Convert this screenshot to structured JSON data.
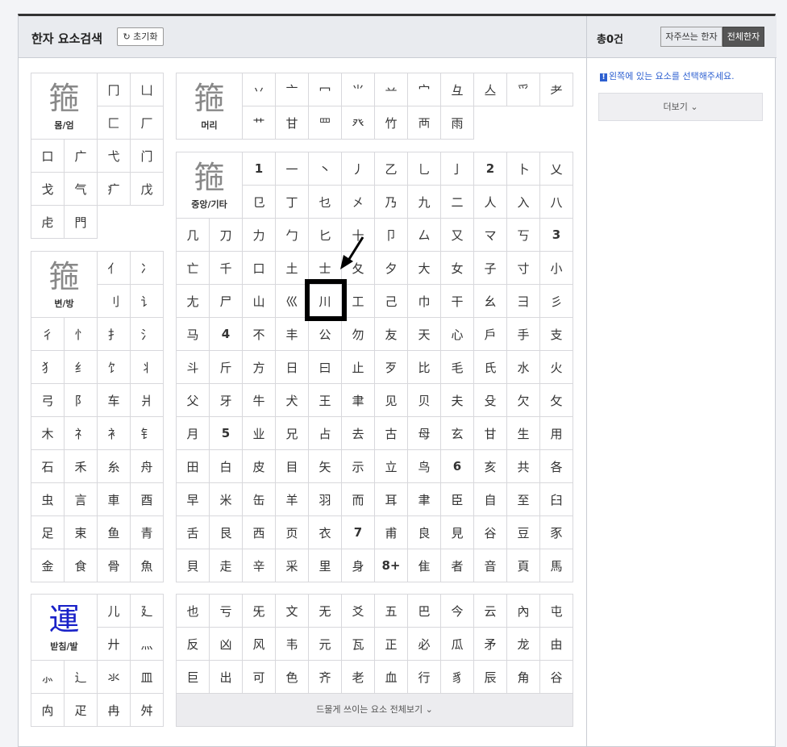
{
  "header": {
    "title": "한자 요소검색",
    "reset_label": "초기화"
  },
  "right": {
    "count": "총0건",
    "toggle_common": "자주쓰는 한자",
    "toggle_all": "전체한자",
    "hint": "왼쪽에 있는 요소를 선택해주세요.",
    "more": "더보기"
  },
  "icons": {
    "reset": "refresh-icon",
    "hint": "exclamation-icon",
    "more": "chevron-down-icon"
  },
  "colors": {
    "accent": "#1a22c8",
    "hint": "#2c5fd0"
  },
  "groups": {
    "mom": {
      "sample": "箍",
      "label": "몸/엄",
      "items": [
        "冂",
        "凵",
        "匚",
        "厂",
        "口",
        "广",
        "弋",
        "门",
        "戈",
        "气",
        "疒",
        "戊",
        "虍",
        "門"
      ]
    },
    "head": {
      "sample": "箍",
      "label": "머리",
      "items": [
        "丷",
        "亠",
        "冖",
        "⺌",
        "䒑",
        "宀",
        "彑",
        "亼",
        "⺤",
        "耂",
        "艹",
        "甘",
        "罒",
        "癶",
        "竹",
        "襾",
        "雨"
      ]
    },
    "mid": {
      "sample": "箍",
      "label": "중앙/기타",
      "items": [
        "1",
        "一",
        "丶",
        "丿",
        "乙",
        "乚",
        "亅",
        "2",
        "卜",
        "乂",
        "㔾",
        "丁",
        "乜",
        "㐅",
        "乃",
        "九",
        "二",
        "人",
        "入",
        "八",
        "几",
        "刀",
        "力",
        "勹",
        "匕",
        "十",
        "卩",
        "厶",
        "又",
        "マ",
        "丂",
        "3",
        "亡",
        "千",
        "口",
        "土",
        "士",
        "夂",
        "夕",
        "大",
        "女",
        "子",
        "寸",
        "小",
        "尢",
        "尸",
        "山",
        "巛",
        "川",
        "工",
        "己",
        "巾",
        "干",
        "幺",
        "彐",
        "彡",
        "马",
        "4",
        "不",
        "丰",
        "公",
        "勿",
        "友",
        "天",
        "心",
        "戶",
        "手",
        "支",
        "斗",
        "斤",
        "方",
        "日",
        "曰",
        "止",
        "歹",
        "比",
        "毛",
        "氏",
        "水",
        "火",
        "父",
        "牙",
        "牛",
        "犬",
        "王",
        "聿",
        "见",
        "贝",
        "夫",
        "殳",
        "欠",
        "攵",
        "月",
        "5",
        "业",
        "兄",
        "占",
        "去",
        "古",
        "母",
        "玄",
        "甘",
        "生",
        "用",
        "田",
        "白",
        "皮",
        "目",
        "矢",
        "示",
        "立",
        "鸟",
        "6",
        "亥",
        "共",
        "各",
        "早",
        "米",
        "缶",
        "羊",
        "羽",
        "而",
        "耳",
        "聿",
        "臣",
        "自",
        "至",
        "臼",
        "舌",
        "艮",
        "西",
        "页",
        "衣",
        "7",
        "甫",
        "良",
        "見",
        "谷",
        "豆",
        "豕",
        "貝",
        "走",
        "辛",
        "采",
        "里",
        "身",
        "8+",
        "隹",
        "者",
        "音",
        "頁",
        "馬"
      ]
    },
    "side": {
      "sample": "箍",
      "label": "변/방",
      "items": [
        "亻",
        "冫",
        "刂",
        "讠",
        "彳",
        "忄",
        "扌",
        "氵",
        "犭",
        "纟",
        "饣",
        "丬",
        "弓",
        "阝",
        "车",
        "爿",
        "木",
        "礻",
        "衤",
        "钅",
        "石",
        "禾",
        "糸",
        "舟",
        "虫",
        "言",
        "車",
        "酉",
        "足",
        "束",
        "鱼",
        "青",
        "金",
        "食",
        "骨",
        "魚"
      ]
    },
    "base": {
      "sample": "運",
      "label": "받침/발",
      "items": [
        "儿",
        "廴",
        "廾",
        "灬",
        "⺗",
        "辶",
        "氺",
        "皿",
        "禸",
        "疋",
        "冉",
        "舛"
      ]
    },
    "rare": {
      "items": [
        "也",
        "亏",
        "旡",
        "文",
        "无",
        "爻",
        "五",
        "巴",
        "今",
        "云",
        "內",
        "屯",
        "反",
        "凶",
        "风",
        "韦",
        "元",
        "瓦",
        "正",
        "必",
        "瓜",
        "矛",
        "龙",
        "由",
        "巨",
        "出",
        "可",
        "色",
        "齐",
        "老",
        "血",
        "行",
        "豸",
        "辰",
        "角",
        "谷"
      ],
      "more_label": "드물게 쓰이는 요소 전체보기"
    }
  }
}
